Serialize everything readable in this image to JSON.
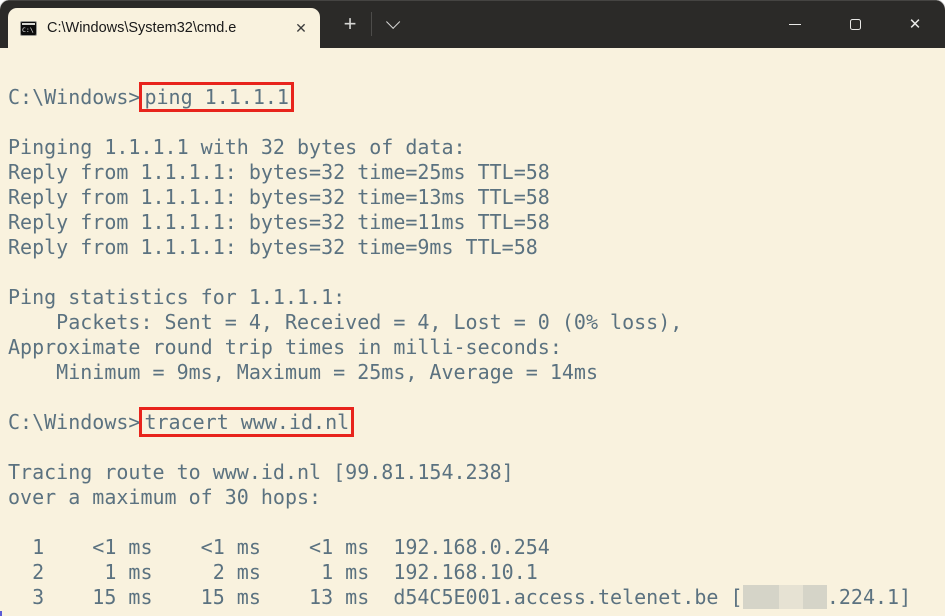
{
  "window": {
    "tab": {
      "icon_text": "C:\\",
      "title": "C:\\Windows\\System32\\cmd.e",
      "close_glyph": "✕"
    },
    "new_tab_glyph": "+",
    "controls": {
      "close_glyph": "✕"
    }
  },
  "colors": {
    "titlebar_bg": "#2b2a28",
    "terminal_bg": "#f9f2de",
    "terminal_fg": "#5b7280",
    "highlight_red": "#e8241c",
    "redaction_gray": "#d5d4c8"
  },
  "terminal": {
    "lines": [
      [
        {
          "t": "C:\\Windows>"
        },
        {
          "t": "ping 1.1.1.1",
          "hl": "redbox"
        }
      ],
      [
        {
          "t": ""
        }
      ],
      [
        {
          "t": "Pinging 1.1.1.1 with 32 bytes of data:"
        }
      ],
      [
        {
          "t": "Reply from 1.1.1.1: bytes=32 time=25ms TTL=58"
        }
      ],
      [
        {
          "t": "Reply from 1.1.1.1: bytes=32 time=13ms TTL=58"
        }
      ],
      [
        {
          "t": "Reply from 1.1.1.1: bytes=32 time=11ms TTL=58"
        }
      ],
      [
        {
          "t": "Reply from 1.1.1.1: bytes=32 time=9ms TTL=58"
        }
      ],
      [
        {
          "t": ""
        }
      ],
      [
        {
          "t": "Ping statistics for 1.1.1.1:"
        }
      ],
      [
        {
          "t": "    Packets: Sent = 4, Received = 4, Lost = 0 (0% loss),"
        }
      ],
      [
        {
          "t": "Approximate round trip times in milli-seconds:"
        }
      ],
      [
        {
          "t": "    Minimum = 9ms, Maximum = 25ms, Average = 14ms"
        }
      ],
      [
        {
          "t": ""
        }
      ],
      [
        {
          "t": "C:\\Windows>"
        },
        {
          "t": "tracert www.id.nl",
          "hl": "redbox"
        }
      ],
      [
        {
          "t": ""
        }
      ],
      [
        {
          "t": "Tracing route to www.id.nl [99.81.154.238]"
        }
      ],
      [
        {
          "t": "over a maximum of 30 hops:"
        }
      ],
      [
        {
          "t": ""
        }
      ],
      [
        {
          "t": "  1    <1 ms    <1 ms    <1 ms  192.168.0.254"
        }
      ],
      [
        {
          "t": "  2     1 ms     2 ms     1 ms  192.168.10.1"
        }
      ],
      [
        {
          "t": "  3    15 ms    15 ms    13 ms  d54C5E001.access.telenet.be ["
        },
        {
          "t": "   ",
          "hl": "redact"
        },
        {
          "t": "  ",
          "hl": "redact-gap"
        },
        {
          "t": "  ",
          "hl": "redact"
        },
        {
          "t": ".224.1]"
        }
      ]
    ]
  }
}
